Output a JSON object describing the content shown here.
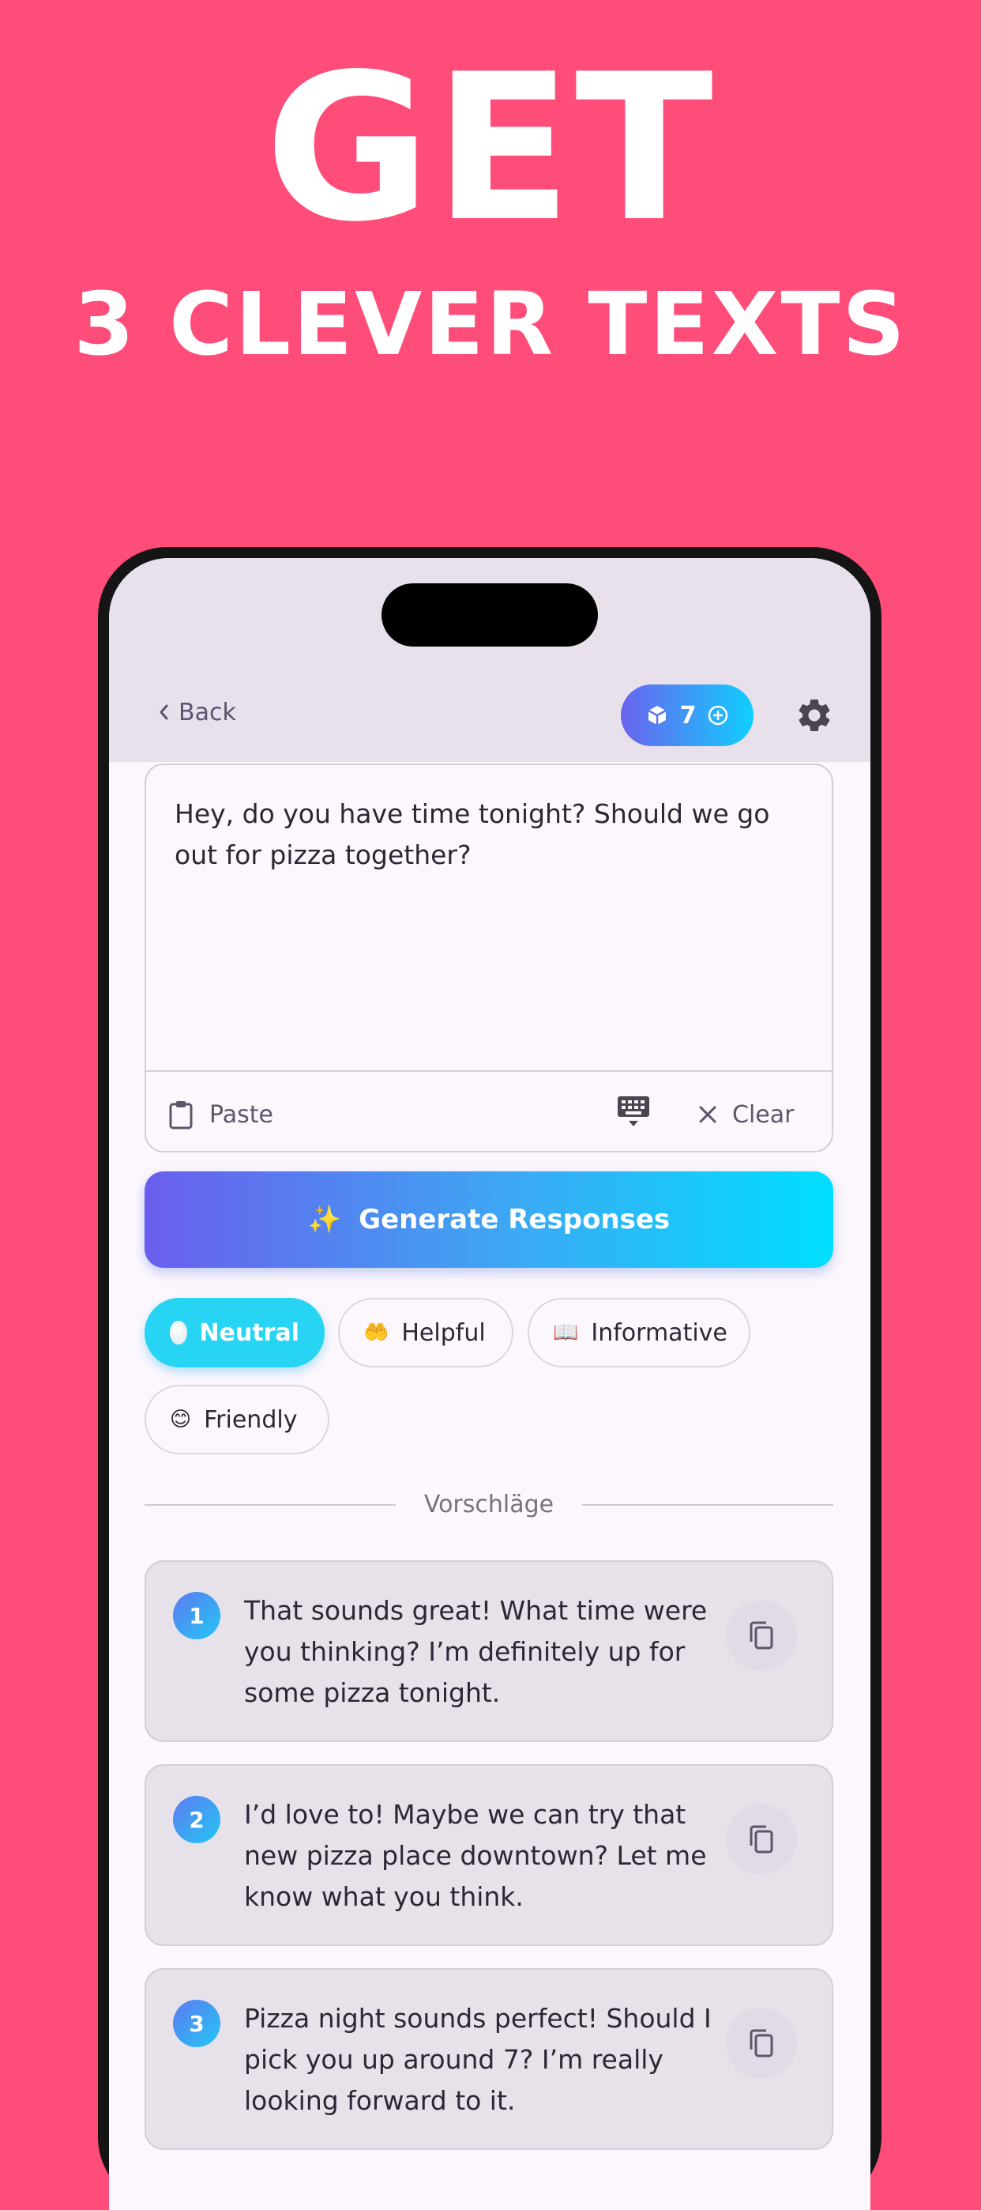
{
  "headline": {
    "line1": "GET",
    "line2": "3 CLEVER TEXTS"
  },
  "header": {
    "back_label": "Back",
    "credits": "7"
  },
  "input": {
    "text": "Hey, do you have time tonight? Should we go out for pizza together?",
    "paste_label": "Paste",
    "clear_label": "Clear"
  },
  "generate": {
    "emoji": "✨",
    "label": "Generate Responses"
  },
  "tones": [
    {
      "label": "Neutral",
      "active": true
    },
    {
      "label": "Helpful",
      "emoji": "🤲",
      "active": false
    },
    {
      "label": "Informative",
      "emoji": "📖",
      "active": false
    },
    {
      "label": "Friendly",
      "emoji": "😊",
      "active": false
    }
  ],
  "suggestions_header": "Vorschläge",
  "suggestions": [
    {
      "number": "1",
      "text": "That sounds great! What time were you thinking? I’m definitely up for some pizza tonight."
    },
    {
      "number": "2",
      "text": "I’d love to! Maybe we can try that new pizza place downtown? Let me know what you think."
    },
    {
      "number": "3",
      "text": "Pizza night sounds perfect! Should I pick you up around 7? I’m really looking forward to it."
    }
  ],
  "colors": {
    "background": "#FF4D7A",
    "accent_start": "#6A5EEC",
    "accent_end": "#00DFFF",
    "chip_active": "#27D4F3"
  }
}
